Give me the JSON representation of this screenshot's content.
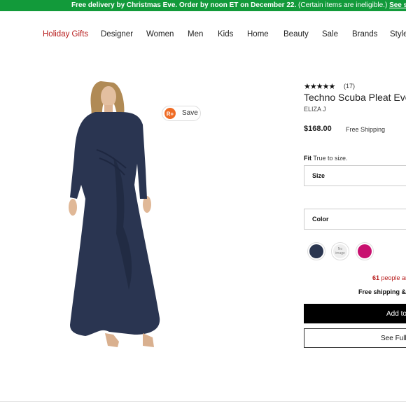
{
  "promo": {
    "text_bold": "Free delivery by Christmas Eve. Order by noon ET on December 22.",
    "text_normal": " (Certain items are ineligible.) ",
    "link": "See shipping deadlines.",
    "bg_color": "#129a3a"
  },
  "nav": {
    "items": [
      "Holiday Gifts",
      "Designer",
      "Women",
      "Men",
      "Kids",
      "Home",
      "Beauty",
      "Sale",
      "Brands",
      "Style"
    ],
    "highlight_color": "#b71c1c"
  },
  "save_button": {
    "label": "Save",
    "icon": "r-plus-icon",
    "icon_text": "R+"
  },
  "product": {
    "stars": "★★★★★",
    "rating": 4.5,
    "review_count": "(17)",
    "title": "Techno Scuba Pleat Eveni",
    "brand": "ELIZA J",
    "price": "$168.00",
    "shipping": "Free Shipping",
    "fit_label": "Fit",
    "fit_value": "True to size.",
    "size_label": "Size",
    "color_label": "Color",
    "swatches": [
      {
        "name": "navy",
        "color": "#2b3650"
      },
      {
        "name": "no image",
        "label": "No image"
      },
      {
        "name": "magenta",
        "color": "#c8106f"
      }
    ],
    "people_count": "61",
    "people_text": " people ar",
    "free_shipping_returns": "Free shipping & i",
    "add_to_bag": "Add to",
    "see_full": "See Full D"
  }
}
